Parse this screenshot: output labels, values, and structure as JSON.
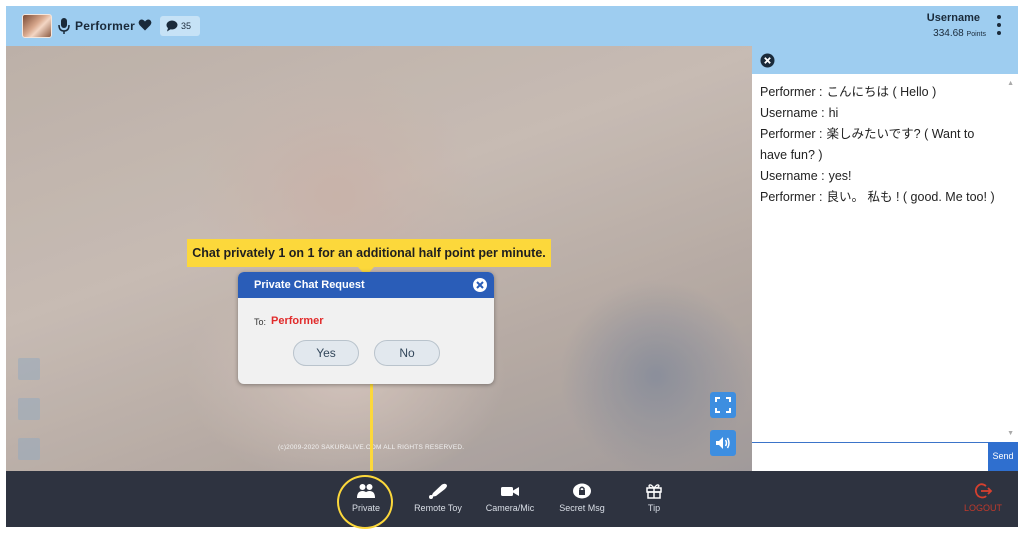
{
  "topbar": {
    "performer_name": "Performer",
    "viewer_count": "35",
    "username": "Username",
    "points_value": "334.68",
    "points_unit": "Points"
  },
  "video": {
    "copyright": "(c)2009-2020 SAKURALIVE.COM ALL RIGHTS RESERVED."
  },
  "callout": {
    "text": "Chat privately 1 on 1 for an additional half point per minute."
  },
  "dialog": {
    "title": "Private Chat Request",
    "to_label": "To:",
    "to_value": "Performer",
    "yes_label": "Yes",
    "no_label": "No"
  },
  "chat": {
    "messages": [
      {
        "who": "Performer :",
        "text": "こんにちは ( Hello )"
      },
      {
        "who": "Username :",
        "text": "hi"
      },
      {
        "who": "Performer :",
        "text": "楽しみたいです? ( Want to have fun? )"
      },
      {
        "who": "Username :",
        "text": "yes!"
      },
      {
        "who": "Performer :",
        "text": "良い。 私も ! ( good. Me too! )"
      }
    ],
    "input_value": "",
    "send_label": "Send"
  },
  "toolbar": {
    "items": [
      {
        "label": "Private",
        "icon": "private-users-icon"
      },
      {
        "label": "Remote Toy",
        "icon": "remote-toy-icon"
      },
      {
        "label": "Camera/Mic",
        "icon": "camera-icon"
      },
      {
        "label": "Secret Msg",
        "icon": "lock-icon"
      },
      {
        "label": "Tip",
        "icon": "gift-icon"
      }
    ],
    "logout_label": "LOGOUT"
  },
  "colors": {
    "header_bg": "#9ecdf0",
    "toolbar_bg": "#2e3340",
    "accent_blue": "#2a5db8",
    "highlight_yellow": "#fcd83b",
    "performer_red": "#e12b2b"
  }
}
